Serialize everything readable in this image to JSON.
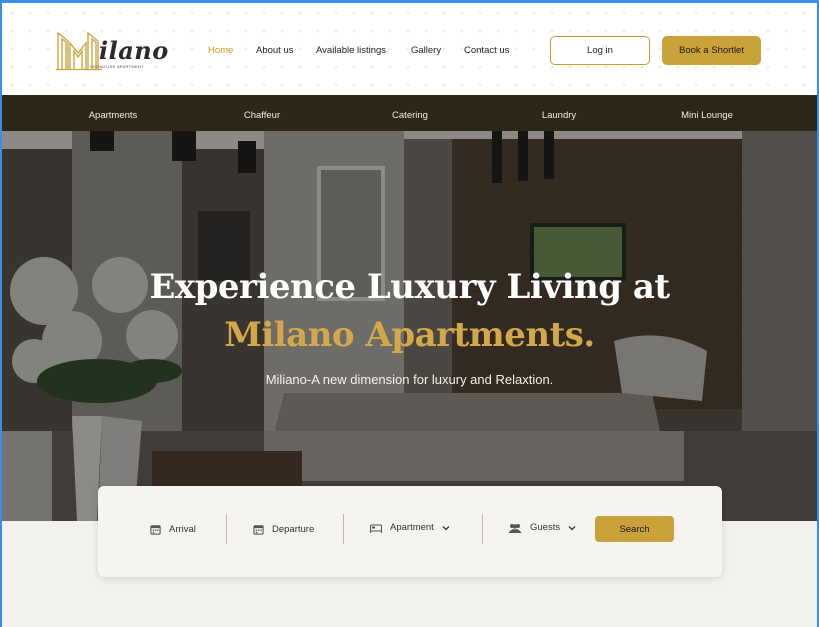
{
  "brand": {
    "wordmark": "ilano",
    "tagline": "SIGNATURE APARTMENT",
    "accent": "#c9a23a"
  },
  "nav": {
    "home": "Home",
    "about": "About us",
    "listings": "Available listings",
    "gallery": "Gallery",
    "contact": "Contact us"
  },
  "actions": {
    "login": "Log in",
    "book": "Book a Shortlet"
  },
  "services": [
    "Apartments",
    "Chaffeur",
    "Catering",
    "Laundry",
    "Mini Lounge"
  ],
  "hero": {
    "title_line1": "Experience Luxury Living at",
    "title_line2": "Milano Apartments.",
    "subtitle": "Miliano-A new dimension for luxury and Relaxtion."
  },
  "search": {
    "arrival": "Arrival",
    "departure": "Departure",
    "apartment": "Apartment",
    "guests": "Guests",
    "button": "Search"
  },
  "icons": {
    "arrival": "calendar-icon",
    "departure": "calendar-icon",
    "apartment": "bed-icon",
    "guests": "users-icon",
    "dropdown": "chevron-down-icon"
  }
}
